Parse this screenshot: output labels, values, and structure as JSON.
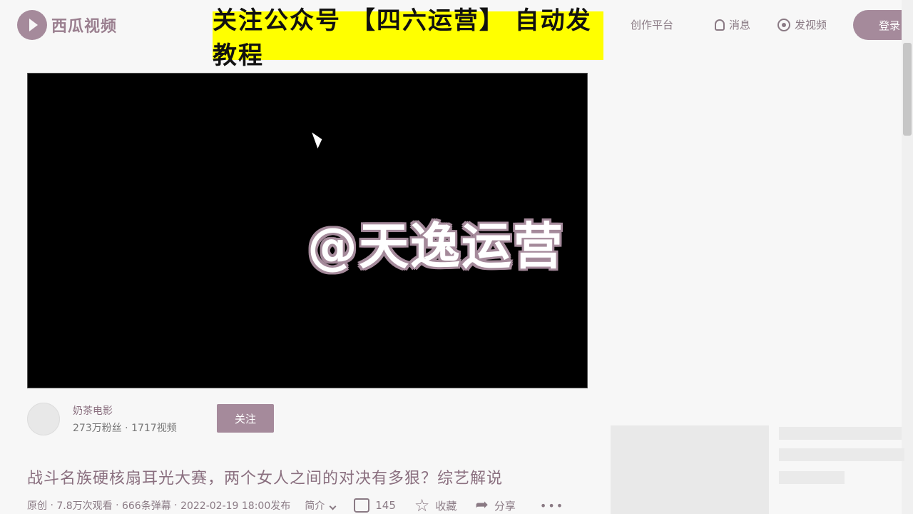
{
  "header": {
    "logo_text": "西瓜视频",
    "promo_banner": "关注公众号 【四六运营】 自动发教程",
    "nav": {
      "creator_platform": "创作平台",
      "messages": "消息",
      "upload_video": "发视频",
      "login": "登录"
    }
  },
  "player": {
    "watermark": "@天逸运营"
  },
  "author": {
    "name": "奶茶电影",
    "stats": "273万粉丝 · 1717视频",
    "follow_label": "关注"
  },
  "video": {
    "title": "战斗名族硬核扇耳光大赛，两个女人之间的对决有多狠？综艺解说",
    "original_tag": "原创",
    "views": "7.8万次观看",
    "danmaku": "666条弹幕",
    "published": "2022-02-19 18:00发布",
    "intro_label": "简介",
    "likes": "145",
    "favorite_label": "收藏",
    "share_label": "分享",
    "more": "•••"
  },
  "colors": {
    "accent": "#a58a9b",
    "promo_bg": "#ffff00"
  }
}
